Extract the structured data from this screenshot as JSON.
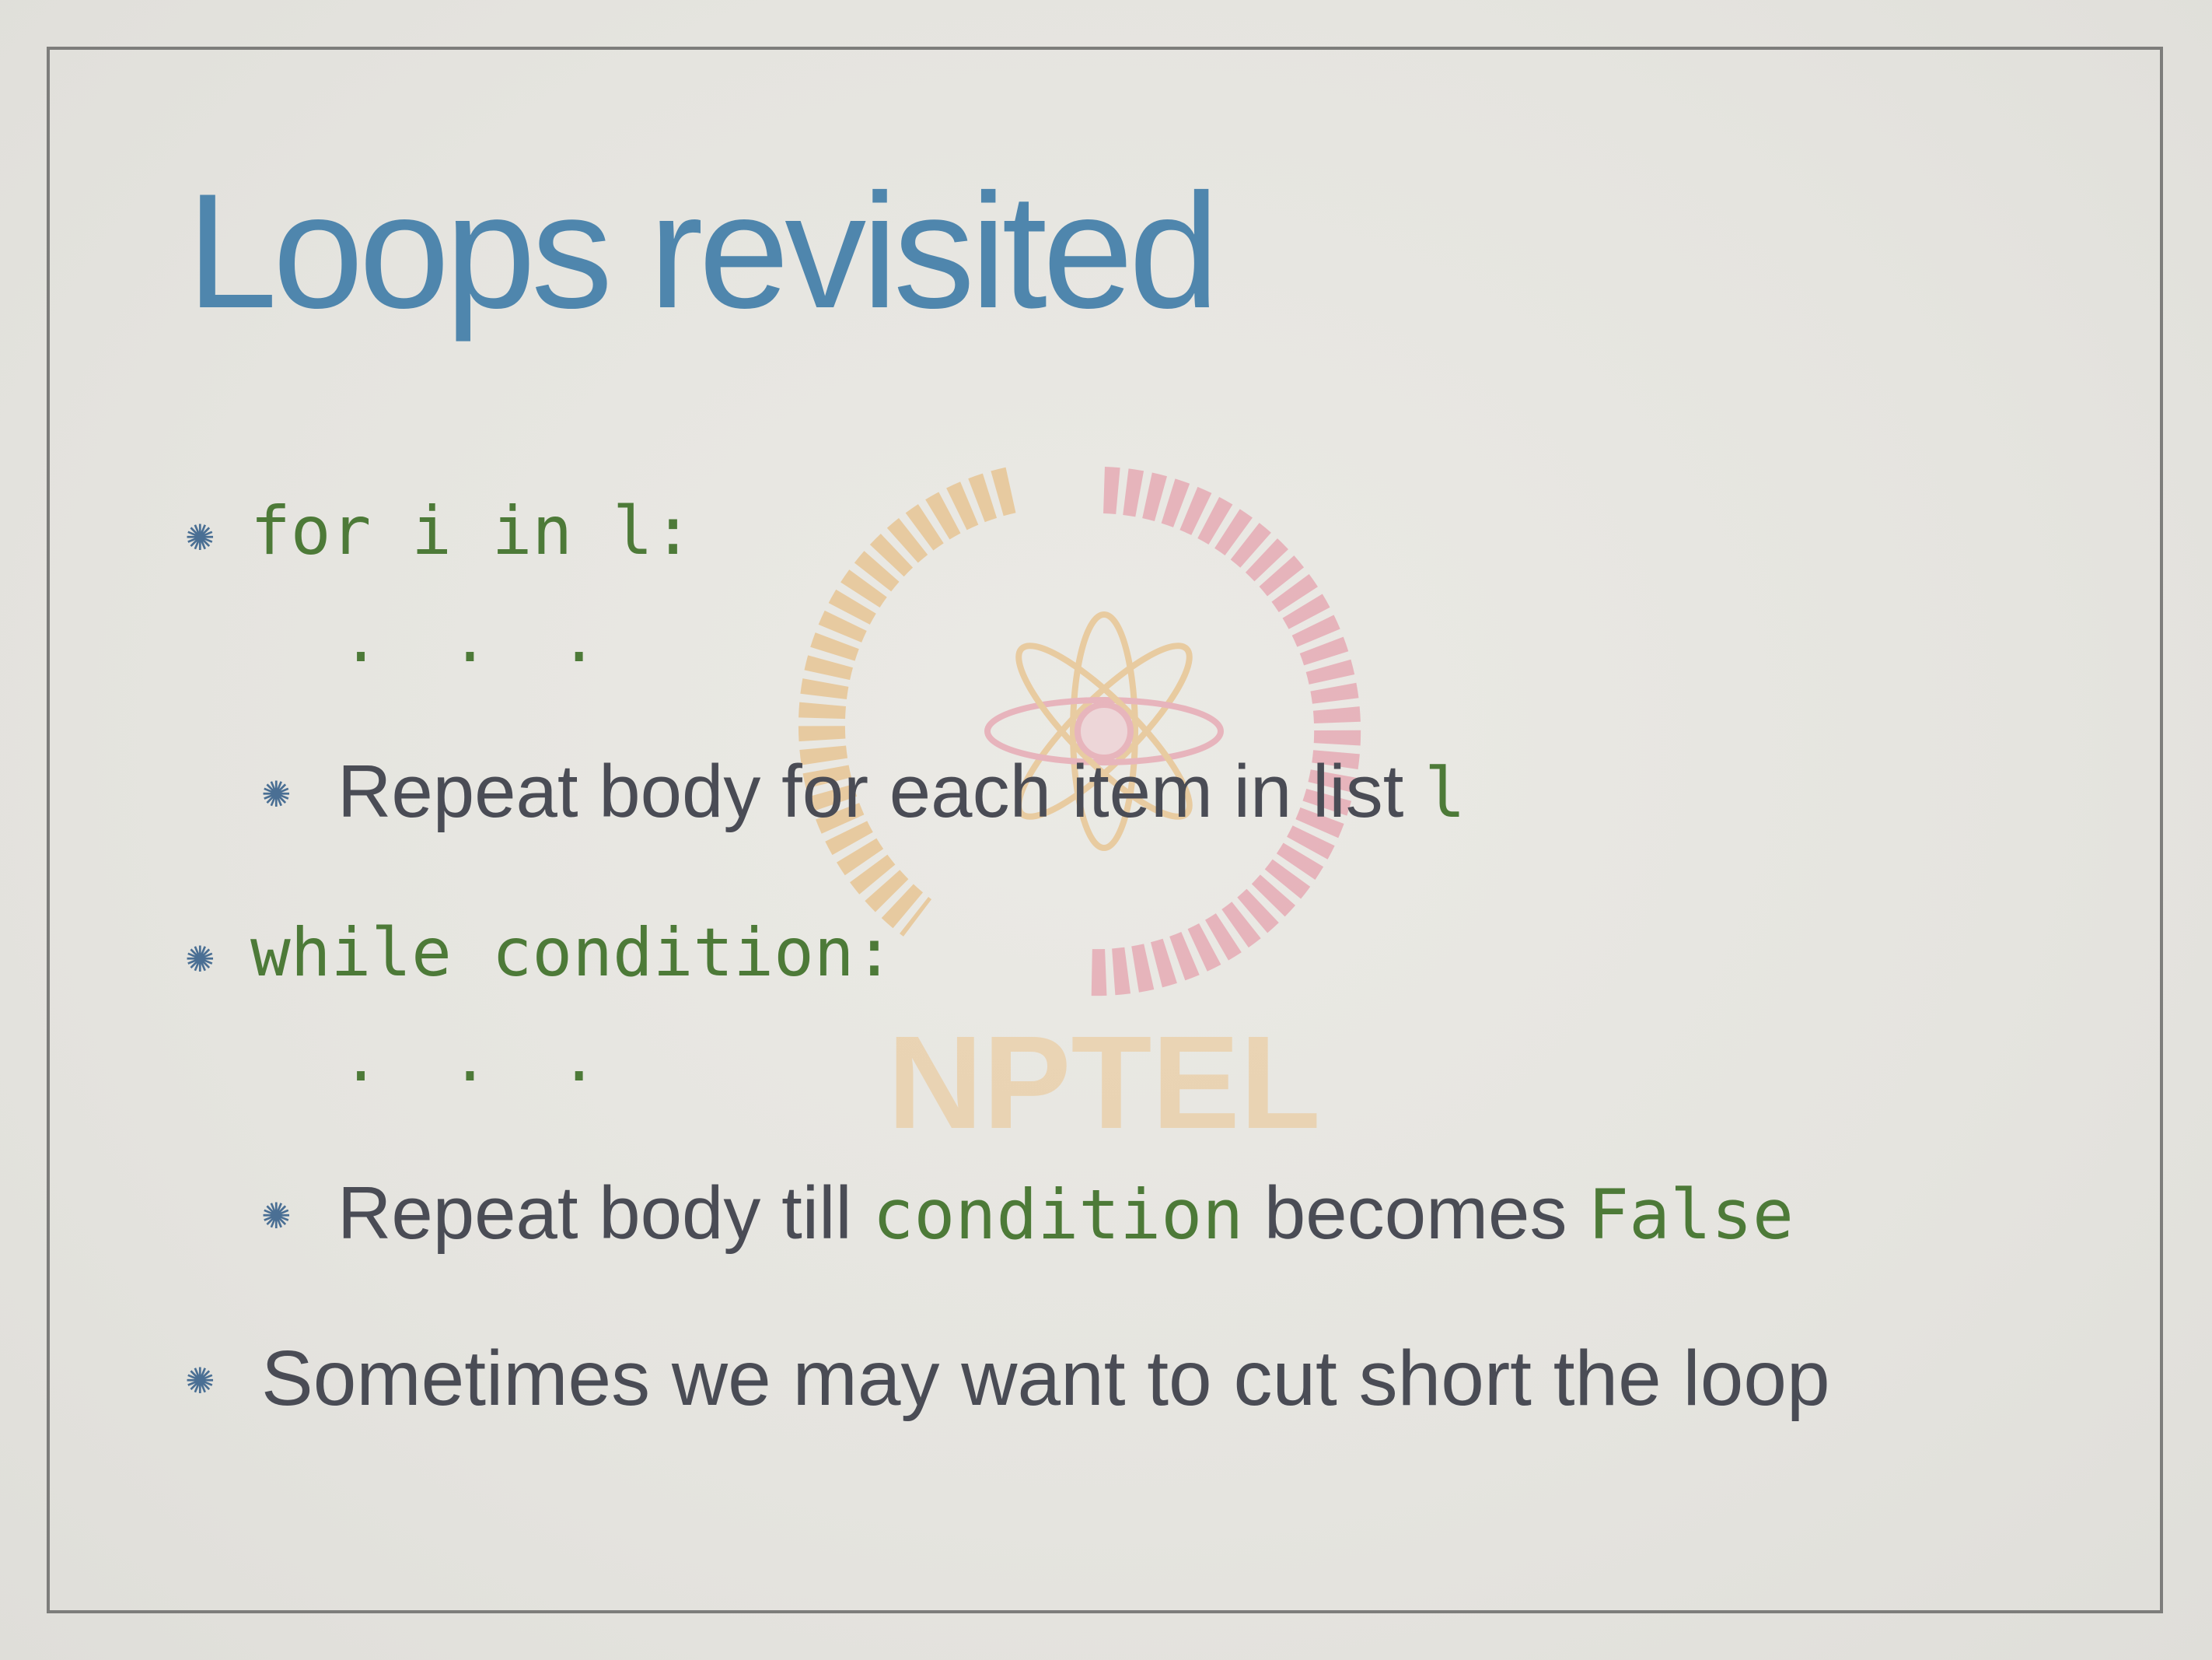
{
  "slide": {
    "title": "Loops revisited",
    "watermark_text": "NPTEL",
    "bullet_glyph": "✺",
    "items": [
      {
        "code": "for i in l:",
        "ellipsis": ". . .",
        "sub": {
          "text_before": "Repeat body for each item in list ",
          "code": "l"
        }
      },
      {
        "code": "while condition:",
        "ellipsis": ". . .",
        "sub": {
          "text_before": "Repeat body till ",
          "code_1": "condition",
          "text_middle": " becomes ",
          "code_2": "False"
        }
      },
      {
        "text": "Sometimes we may want to cut short the loop"
      }
    ]
  },
  "colors": {
    "title": "#4f86ad",
    "code": "#4d7a38",
    "prose": "#4a4c55",
    "bullet": "#4a6f94",
    "frame": "#7d7d7b",
    "background": "#e6e5e0"
  }
}
